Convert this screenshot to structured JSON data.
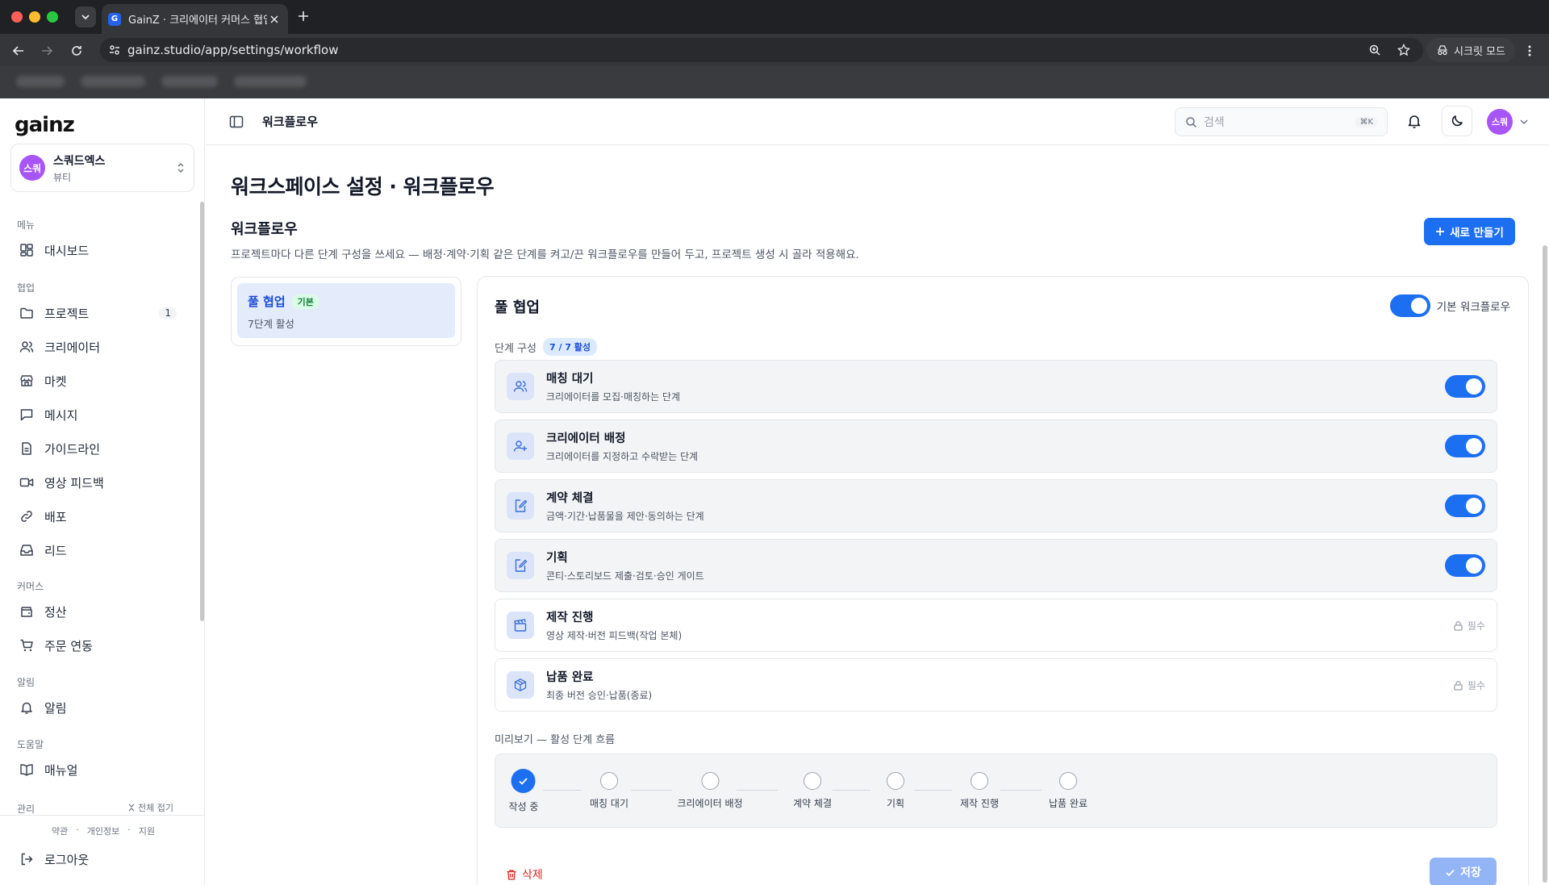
{
  "browser": {
    "tab_title": "GainZ · 크리에이터 커머스 협업 C",
    "tab_favicon": "G",
    "url": "gainz.studio/app/settings/workflow",
    "incognito_label": "시크릿 모드"
  },
  "sidebar": {
    "logo": "gainz",
    "workspace": {
      "avatar": "스쿼",
      "name": "스쿼드엑스",
      "category": "뷰티"
    },
    "sections": {
      "menu": "메뉴",
      "collab": "협업",
      "commerce": "커머스",
      "alerts": "알림",
      "help": "도움말",
      "admin": "관리"
    },
    "items": {
      "dashboard": "대시보드",
      "projects": "프로젝트",
      "projects_count": "1",
      "creators": "크리에이터",
      "market": "마켓",
      "messages": "메시지",
      "guidelines": "가이드라인",
      "video_feedback": "영상 피드백",
      "deploy": "배포",
      "leads": "리드",
      "settlement": "정산",
      "order_sync": "주문 연동",
      "notifications": "알림",
      "manual": "매뉴얼"
    },
    "collapse_all": "전체 접기",
    "footer_links": [
      "약관",
      "개인정보",
      "지원"
    ],
    "footer_sep": "·",
    "logout": "로그아웃"
  },
  "topbar": {
    "title": "워크플로우",
    "search_placeholder": "검색",
    "search_shortcut": "⌘K",
    "user_avatar": "스쿼"
  },
  "page": {
    "heading": "워크스페이스 설정 · 워크플로우",
    "section_title": "워크플로우",
    "section_desc": "프로젝트마다 다른 단계 구성을 쓰세요 — 배정·계약·기획 같은 단계를 켜고/끈 워크플로우를 만들어 두고, 프로젝트 생성 시 골라 적용해요.",
    "new_button": "새로 만들기"
  },
  "workflow_list": [
    {
      "name": "풀 협업",
      "badge": "기본",
      "summary": "7단계 활성"
    }
  ],
  "editor": {
    "title": "풀 협업",
    "default_toggle_label": "기본 워크플로우",
    "default_toggle_on": true,
    "stages_label": "단계 구성",
    "stages_count": "7 / 7 활성",
    "stages": [
      {
        "name": "매칭 대기",
        "desc": "크리에이터를 모집·매칭하는 단계",
        "icon": "users-icon",
        "state": "on"
      },
      {
        "name": "크리에이터 배정",
        "desc": "크리에이터를 지정하고 수락받는 단계",
        "icon": "user-plus-icon",
        "state": "on"
      },
      {
        "name": "계약 체결",
        "desc": "금액·기간·납품물을 제안·동의하는 단계",
        "icon": "edit-document-icon",
        "state": "on"
      },
      {
        "name": "기획",
        "desc": "콘티·스토리보드 제출·검토·승인 게이트",
        "icon": "edit-document-icon",
        "state": "on"
      },
      {
        "name": "제작 진행",
        "desc": "영상 제작·버전 피드백(작업 본체)",
        "icon": "clapperboard-icon",
        "state": "required",
        "required_label": "필수"
      },
      {
        "name": "납품 완료",
        "desc": "최종 버전 승인·납품(종료)",
        "icon": "package-icon",
        "state": "required",
        "required_label": "필수"
      }
    ],
    "preview_label": "미리보기 — 활성 단계 흐름",
    "preview_steps": [
      "작성 중",
      "매칭 대기",
      "크리에이터 배정",
      "계약 체결",
      "기획",
      "제작 진행",
      "납품 완료"
    ],
    "delete_label": "삭제",
    "save_label": "저장"
  },
  "colors": {
    "accent": "#1d6ff2",
    "avatar": "#a855f7",
    "danger": "#dc2626",
    "default_badge": "#15803d"
  }
}
